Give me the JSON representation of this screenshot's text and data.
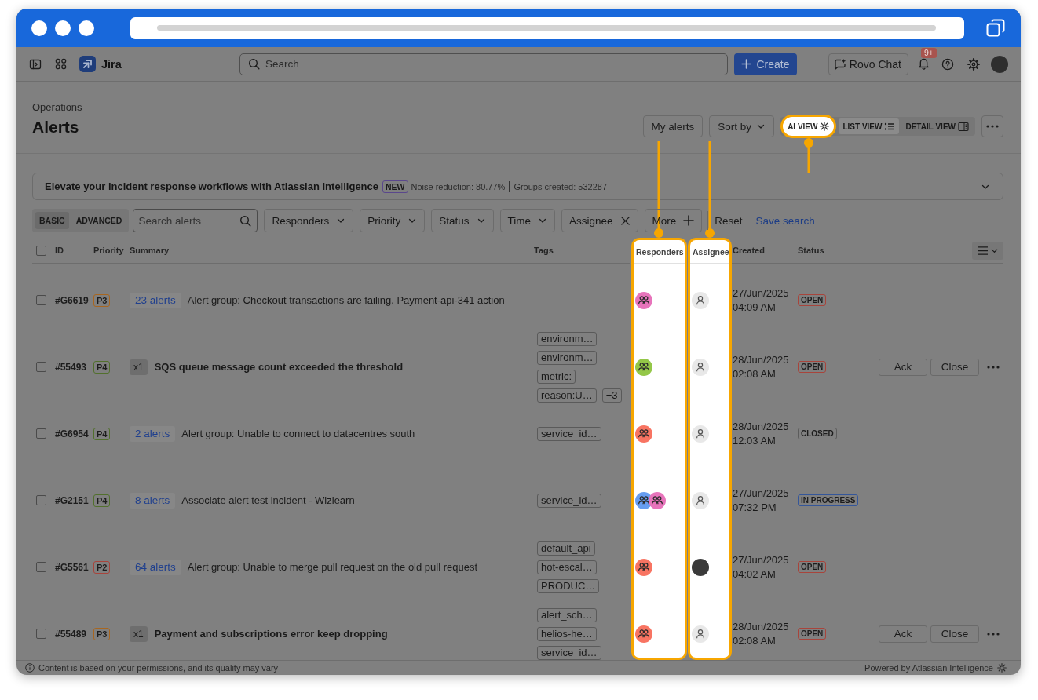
{
  "top_nav": {
    "product": "Jira",
    "search": {
      "placeholder": "Search"
    },
    "create": "Create",
    "chat": "Rovo Chat",
    "notification_badge": "9+"
  },
  "page": {
    "breadcrumb": "Operations",
    "title": "Alerts",
    "buttons": [
      {
        "label": "My alerts",
        "kind": "plain"
      },
      {
        "label": "Sort by",
        "kind": "dropdown"
      }
    ],
    "views": [
      {
        "label": "AI VIEW",
        "kind": "ai",
        "selected": false,
        "spotlight": true
      },
      {
        "label": "LIST VIEW",
        "kind": "list",
        "selected": true,
        "spotlight": false
      },
      {
        "label": "DETAIL VIEW",
        "kind": "detail",
        "selected": false,
        "spotlight": false
      }
    ]
  },
  "banner": {
    "title": "Elevate your incident response workflows with Atlassian Intelligence",
    "badge": "NEW",
    "stats": [
      "Noise reduction: 80.77%",
      "Groups created: 532287"
    ],
    "expanded": false
  },
  "filters": {
    "modes": [
      {
        "label": "BASIC",
        "selected": true
      },
      {
        "label": "ADVANCED",
        "selected": false
      }
    ],
    "search": {
      "placeholder": "Search alerts"
    },
    "chips": [
      {
        "label": "Responders",
        "kind": "dropdown"
      },
      {
        "label": "Priority",
        "kind": "dropdown"
      },
      {
        "label": "Status",
        "kind": "dropdown"
      },
      {
        "label": "Time",
        "kind": "dropdown"
      },
      {
        "label": "Assignee",
        "kind": "clearable"
      },
      {
        "label": "More",
        "kind": "add"
      }
    ],
    "links": [
      {
        "label": "Reset",
        "kind": "plain"
      },
      {
        "label": "Save search",
        "kind": "link"
      }
    ]
  },
  "table": {
    "select_all_checked": false,
    "columns": [
      {
        "label": "ID",
        "spotlight": false
      },
      {
        "label": "Priority",
        "spotlight": false
      },
      {
        "label": "Summary",
        "spotlight": false
      },
      {
        "label": "Tags",
        "spotlight": false
      },
      {
        "label": "Responders",
        "spotlight": true
      },
      {
        "label": "Assignee",
        "spotlight": true
      },
      {
        "label": "Created",
        "spotlight": false
      },
      {
        "label": "Status",
        "spotlight": false
      }
    ],
    "rows": [
      {
        "checked": false,
        "id": "#G6619",
        "priority": {
          "label": "P3",
          "color": "#a8661f"
        },
        "kind": "group",
        "count": "23 alerts",
        "summary": "Alert group: Checkout transactions are failing. Payment-api-341 action",
        "responders": [
          {
            "color": "#e774bb"
          }
        ],
        "assigned": false,
        "created": "27/Jun/2025 04:09 AM",
        "status": {
          "label": "OPEN",
          "color": "#a8443b"
        }
      },
      {
        "checked": false,
        "id": "#55493",
        "priority": {
          "label": "P4",
          "color": "#52702d"
        },
        "kind": "alert",
        "count": "x1",
        "summary": "SQS queue message count exceeded the threshold",
        "tags": [
          "environm…",
          "environm…",
          "metric:",
          "reason:U…"
        ],
        "more_tags": "+3",
        "responders": [
          {
            "color": "#94c748"
          }
        ],
        "assigned": false,
        "created": "28/Jun/2025 02:08 AM",
        "status": {
          "label": "OPEN",
          "color": "#a8443b"
        },
        "actions": [
          "Ack",
          "Close"
        ],
        "more_menu": true
      },
      {
        "checked": false,
        "id": "#G6954",
        "priority": {
          "label": "P4",
          "color": "#52702d"
        },
        "kind": "group",
        "count": "2 alerts",
        "summary": "Alert group: Unable to connect to datacentres south",
        "tags": [
          "service_id…"
        ],
        "responders": [
          {
            "color": "#f87462"
          }
        ],
        "assigned": false,
        "created": "28/Jun/2025 12:03 AM",
        "status": {
          "label": "CLOSED",
          "color": "#5c5c5c"
        }
      },
      {
        "checked": false,
        "id": "#G2151",
        "priority": {
          "label": "P4",
          "color": "#52702d"
        },
        "kind": "group",
        "count": "8 alerts",
        "summary": "Associate alert test incident - Wizlearn",
        "tags": [
          "service_id…"
        ],
        "responders": [
          {
            "color": "#669df1"
          },
          {
            "color": "#e774bb"
          }
        ],
        "assigned": false,
        "created": "27/Jun/2025 07:32 PM",
        "status": {
          "label": "IN PROGRESS",
          "color": "#34569a"
        }
      },
      {
        "checked": false,
        "id": "#G5561",
        "priority": {
          "label": "P2",
          "color": "#a8443b"
        },
        "kind": "group",
        "count": "64 alerts",
        "summary": "Alert group: Unable to merge pull request on the old pull request",
        "tags": [
          "default_api",
          "hot-escal…",
          "PRODUC…"
        ],
        "responders": [
          {
            "color": "#f87462"
          }
        ],
        "assigned": true,
        "created": "27/Jun/2025 04:02 AM",
        "status": {
          "label": "OPEN",
          "color": "#a8443b"
        }
      },
      {
        "checked": false,
        "id": "#55489",
        "priority": {
          "label": "P3",
          "color": "#a8661f"
        },
        "kind": "alert",
        "count": "x1",
        "summary": "Payment and subscriptions error keep dropping",
        "tags": [
          "alert_sch…",
          "helios-he…",
          "service_id…"
        ],
        "responders": [
          {
            "color": "#f87462"
          }
        ],
        "assigned": false,
        "created": "28/Jun/2025 02:08 AM",
        "status": {
          "label": "OPEN",
          "color": "#a8443b"
        },
        "actions": [
          "Ack",
          "Close"
        ],
        "more_menu": true
      }
    ]
  },
  "footer": {
    "note": "Content is based on your permissions, and its quality may vary",
    "credit": "Powered by Atlassian Intelligence"
  }
}
